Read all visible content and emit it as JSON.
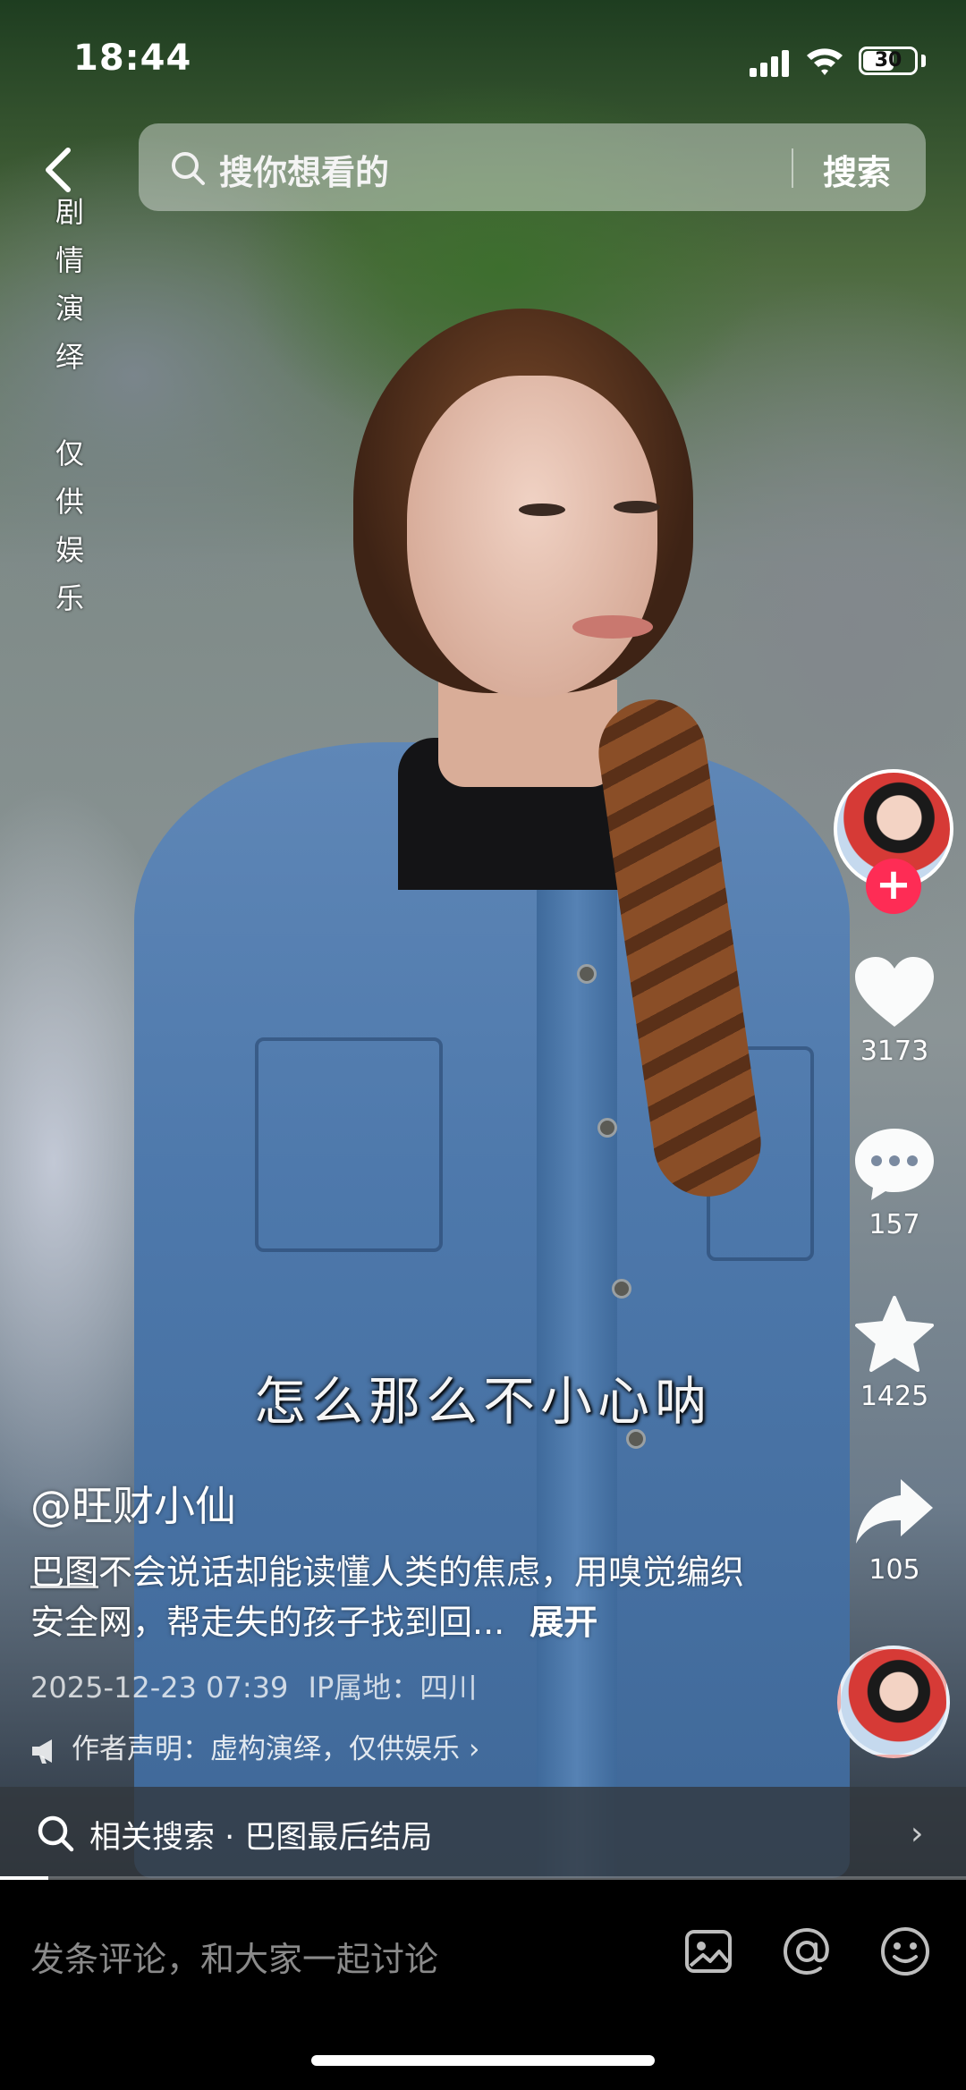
{
  "status_bar": {
    "time": "18:44",
    "battery": "30"
  },
  "watermark": {
    "lines": [
      "剧",
      "情",
      "演",
      "绎",
      "",
      "仅",
      "供",
      "娱",
      "乐"
    ]
  },
  "search": {
    "placeholder": "搜你想看的",
    "button": "搜索"
  },
  "actions": {
    "likes": "3173",
    "comments": "157",
    "favorites": "1425",
    "shares": "105"
  },
  "subtitle": "怎么那么不小心呐",
  "post": {
    "author": "@旺财小仙",
    "desc_tag": "巴图",
    "desc_body": "不会说话却能读懂人类的焦虑，用嗅觉编织安全网，帮走失的孩子找到回...",
    "expand": "展开",
    "date": "2025-12-23 07:39",
    "ip": "IP属地：四川",
    "declaration": "作者声明：虚构演绎，仅供娱乐"
  },
  "related": {
    "text": "相关搜索 · 巴图最后结局"
  },
  "progress": {
    "fraction": 0.05
  },
  "comment": {
    "placeholder": "发条评论，和大家一起讨论"
  },
  "icons": [
    "back-icon",
    "search-icon",
    "heart-icon",
    "comment-icon",
    "star-icon",
    "share-icon",
    "image-icon",
    "at-icon",
    "emoji-icon"
  ],
  "colors": {
    "follow": "#fe2c55",
    "bar_bg": "#000000"
  }
}
